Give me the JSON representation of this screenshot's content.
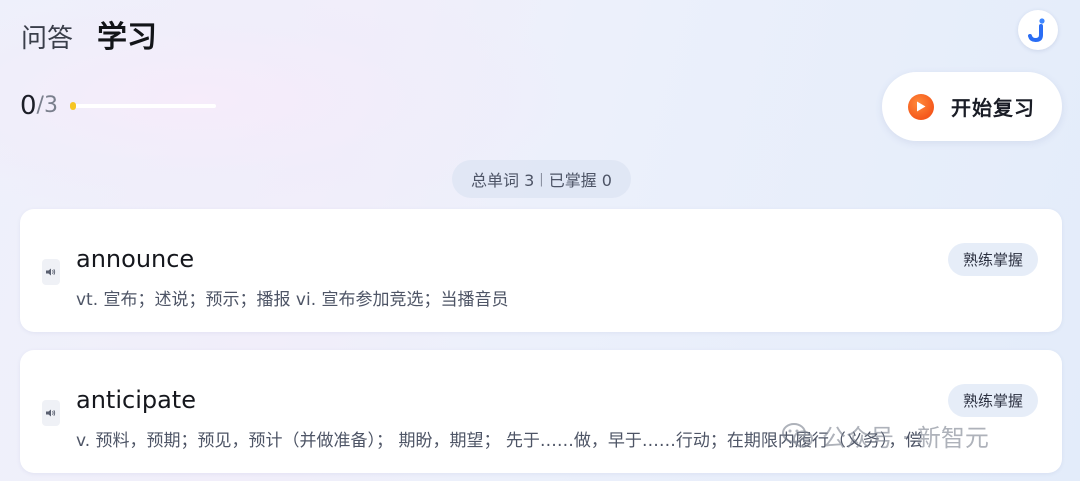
{
  "tabs": [
    {
      "label": "问答",
      "active": false
    },
    {
      "label": "学习",
      "active": true
    }
  ],
  "logo": {
    "icon": "j-logo-icon",
    "letter": "J",
    "color": "#2a6df4"
  },
  "progress": {
    "current": "0",
    "total": "/3",
    "fraction": 0.0
  },
  "review_button": {
    "label": "开始复习",
    "icon": "play-icon",
    "color": "#f5581c"
  },
  "summary": {
    "total_label": "总单词 3",
    "separator": "|",
    "mastered_label": "已掌握 0"
  },
  "words": [
    {
      "word": "announce",
      "definition": "vt. 宣布；述说；预示；播报 vi. 宣布参加竞选；当播音员",
      "action": "熟练掌握",
      "speaker_icon": "speaker-icon"
    },
    {
      "word": "anticipate",
      "definition": "v. 预料，预期；预见，预计（并做准备）；  期盼，期望；  先于……做，早于……行动；在期限内履行（义务），偿",
      "action": "熟练掌握",
      "speaker_icon": "speaker-icon"
    }
  ],
  "watermark": {
    "text": "公众号 · 新智元",
    "icon": "wechat-icon"
  }
}
